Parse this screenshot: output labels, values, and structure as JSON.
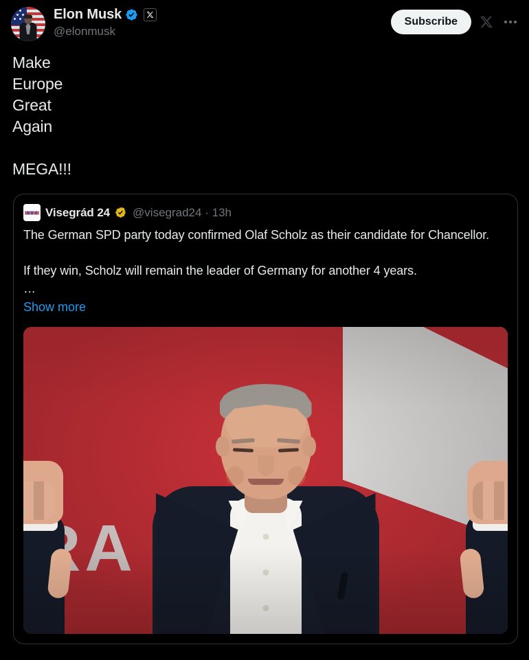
{
  "post": {
    "author": {
      "display_name": "Elon Musk",
      "handle": "@elonmusk",
      "verified_badge": "blue-verified-icon",
      "premium_badge": "x-premium-icon",
      "avatar": "elon-musk-american-flag-avatar"
    },
    "actions": {
      "subscribe_label": "Subscribe",
      "x_logo": "x-logo-icon",
      "more_menu": "more-options-icon"
    },
    "text": "Make\nEurope\nGreat\nAgain\n\nMEGA!!!"
  },
  "quoted_post": {
    "author": {
      "display_name": "Visegrád 24",
      "handle": "@visegrad24",
      "verified_badge": "gold-verified-icon",
      "avatar": "visegrad24-logo-avatar"
    },
    "separator": "·",
    "timestamp": "13h",
    "text": "The German SPD party today confirmed Olaf Scholz as their candidate for Chancellor.\n\nIf they win, Scholz will remain the leader of Germany for another 4 years.\n…",
    "show_more_label": "Show more",
    "media": {
      "alt": "Olaf Scholz giving two thumbs up in front of a red and white SPD backdrop",
      "backdrop_text": "RA"
    }
  },
  "colors": {
    "background": "#000000",
    "text_primary": "#e7e9ea",
    "text_secondary": "#71767b",
    "link_blue": "#1d9bf0",
    "verified_blue": "#1d9bf0",
    "verified_gold": "#e2b719",
    "subscribe_bg": "#eff3f4",
    "card_border": "#2f3336",
    "photo_red": "#d2333b"
  }
}
